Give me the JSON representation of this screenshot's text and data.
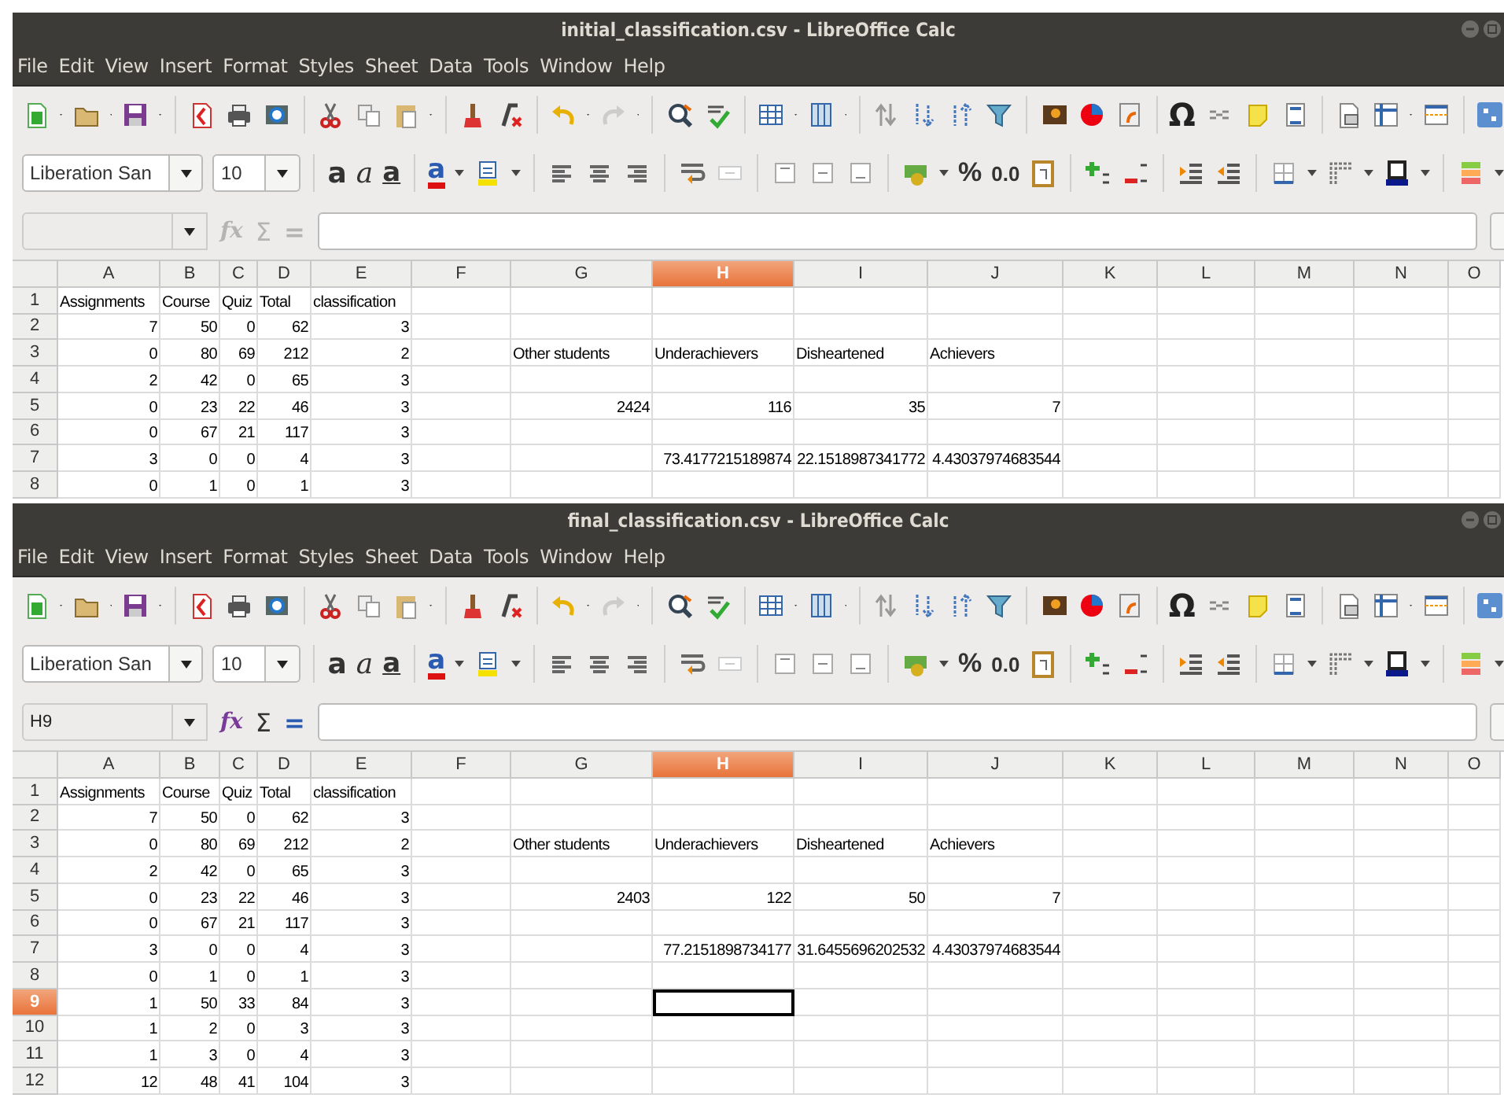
{
  "windows": [
    {
      "title": "initial_classification.csv - LibreOffice Calc",
      "menu": [
        "File",
        "Edit",
        "View",
        "Insert",
        "Format",
        "Styles",
        "Sheet",
        "Data",
        "Tools",
        "Window",
        "Help"
      ],
      "standard_glyphs": [
        {
          "kind": "omega",
          "text": "Ω"
        }
      ],
      "format_toolbar": {
        "font_name": "Liberation San",
        "font_size": "10",
        "glyphs": [
          {
            "kind": "bold",
            "text": "a"
          },
          {
            "kind": "italic",
            "text": "a"
          },
          {
            "kind": "underline",
            "text": "a"
          },
          {
            "kind": "font-color",
            "text": "a"
          },
          {
            "kind": "percent",
            "text": "%"
          },
          {
            "kind": "decimal",
            "text": "0.0"
          }
        ]
      },
      "formula_bar": {
        "buttons": [
          {
            "text": "fx",
            "kind": "function",
            "disabled": true
          },
          {
            "text": "Σ",
            "kind": "sum",
            "disabled": true
          },
          {
            "text": "=",
            "kind": "equals",
            "disabled": true
          }
        ]
      },
      "columns": [
        {
          "label": "A",
          "selected": false
        },
        {
          "label": "B",
          "selected": false
        },
        {
          "label": "C",
          "selected": false
        },
        {
          "label": "D",
          "selected": false
        },
        {
          "label": "E",
          "selected": false
        },
        {
          "label": "F",
          "selected": false
        },
        {
          "label": "G",
          "selected": false
        },
        {
          "label": "H",
          "selected": true
        },
        {
          "label": "I",
          "selected": false
        },
        {
          "label": "J",
          "selected": false
        },
        {
          "label": "K",
          "selected": false
        },
        {
          "label": "L",
          "selected": false
        },
        {
          "label": "M",
          "selected": false
        },
        {
          "label": "N",
          "selected": false
        },
        {
          "label": "O",
          "selected": false
        }
      ],
      "rows": [
        {
          "number": "1",
          "selected": false,
          "cells": [
            {
              "text": "Assignments",
              "kind": "text"
            },
            {
              "text": "Course",
              "kind": "text"
            },
            {
              "text": "Quiz",
              "kind": "text"
            },
            {
              "text": "Total",
              "kind": "text"
            },
            {
              "text": "classification",
              "kind": "text"
            }
          ]
        },
        {
          "number": "2",
          "selected": false,
          "cells": [
            {
              "text": "7",
              "kind": "number"
            },
            {
              "text": "50",
              "kind": "number"
            },
            {
              "text": "0",
              "kind": "number"
            },
            {
              "text": "62",
              "kind": "number"
            },
            {
              "text": "3",
              "kind": "number"
            }
          ]
        },
        {
          "number": "3",
          "selected": false,
          "cells": [
            {
              "text": "0",
              "kind": "number"
            },
            {
              "text": "80",
              "kind": "number"
            },
            {
              "text": "69",
              "kind": "number"
            },
            {
              "text": "212",
              "kind": "number"
            },
            {
              "text": "2",
              "kind": "number"
            },
            null,
            {
              "text": "Other students",
              "kind": "text"
            },
            {
              "text": "Underachievers",
              "kind": "text"
            },
            {
              "text": "Disheartened",
              "kind": "text"
            },
            {
              "text": "Achievers",
              "kind": "text"
            }
          ]
        },
        {
          "number": "4",
          "selected": false,
          "cells": [
            {
              "text": "2",
              "kind": "number"
            },
            {
              "text": "42",
              "kind": "number"
            },
            {
              "text": "0",
              "kind": "number"
            },
            {
              "text": "65",
              "kind": "number"
            },
            {
              "text": "3",
              "kind": "number"
            }
          ]
        },
        {
          "number": "5",
          "selected": false,
          "cells": [
            {
              "text": "0",
              "kind": "number"
            },
            {
              "text": "23",
              "kind": "number"
            },
            {
              "text": "22",
              "kind": "number"
            },
            {
              "text": "46",
              "kind": "number"
            },
            {
              "text": "3",
              "kind": "number"
            },
            null,
            {
              "text": "2424",
              "kind": "number"
            },
            {
              "text": "116",
              "kind": "number"
            },
            {
              "text": "35",
              "kind": "number"
            },
            {
              "text": "7",
              "kind": "number"
            }
          ]
        },
        {
          "number": "6",
          "selected": false,
          "cells": [
            {
              "text": "0",
              "kind": "number"
            },
            {
              "text": "67",
              "kind": "number"
            },
            {
              "text": "21",
              "kind": "number"
            },
            {
              "text": "117",
              "kind": "number"
            },
            {
              "text": "3",
              "kind": "number"
            }
          ]
        },
        {
          "number": "7",
          "selected": false,
          "cells": [
            {
              "text": "3",
              "kind": "number"
            },
            {
              "text": "0",
              "kind": "number"
            },
            {
              "text": "0",
              "kind": "number"
            },
            {
              "text": "4",
              "kind": "number"
            },
            {
              "text": "3",
              "kind": "number"
            },
            null,
            null,
            {
              "text": "73.4177215189874",
              "kind": "number"
            },
            {
              "text": "22.1518987341772",
              "kind": "number"
            },
            {
              "text": "4.43037974683544",
              "kind": "number"
            }
          ]
        },
        {
          "number": "8",
          "selected": false,
          "cells": [
            {
              "text": "0",
              "kind": "number"
            },
            {
              "text": "1",
              "kind": "number"
            },
            {
              "text": "0",
              "kind": "number"
            },
            {
              "text": "1",
              "kind": "number"
            },
            {
              "text": "3",
              "kind": "number"
            }
          ]
        }
      ]
    },
    {
      "title": "final_classification.csv - LibreOffice Calc",
      "menu": [
        "File",
        "Edit",
        "View",
        "Insert",
        "Format",
        "Styles",
        "Sheet",
        "Data",
        "Tools",
        "Window",
        "Help"
      ],
      "standard_glyphs": [
        {
          "kind": "omega",
          "text": "Ω"
        }
      ],
      "format_toolbar": {
        "font_name": "Liberation San",
        "font_size": "10",
        "glyphs": [
          {
            "kind": "bold",
            "text": "a"
          },
          {
            "kind": "italic",
            "text": "a"
          },
          {
            "kind": "underline",
            "text": "a"
          },
          {
            "kind": "font-color",
            "text": "a"
          },
          {
            "kind": "percent",
            "text": "%"
          },
          {
            "kind": "decimal",
            "text": "0.0"
          }
        ]
      },
      "formula_bar": {
        "cell_reference": "H9",
        "buttons": [
          {
            "text": "fx",
            "kind": "function",
            "disabled": false
          },
          {
            "text": "Σ",
            "kind": "sum",
            "disabled": false
          },
          {
            "text": "=",
            "kind": "equals",
            "disabled": false
          }
        ]
      },
      "columns": [
        {
          "label": "A",
          "selected": false
        },
        {
          "label": "B",
          "selected": false
        },
        {
          "label": "C",
          "selected": false
        },
        {
          "label": "D",
          "selected": false
        },
        {
          "label": "E",
          "selected": false
        },
        {
          "label": "F",
          "selected": false
        },
        {
          "label": "G",
          "selected": false
        },
        {
          "label": "H",
          "selected": true
        },
        {
          "label": "I",
          "selected": false
        },
        {
          "label": "J",
          "selected": false
        },
        {
          "label": "K",
          "selected": false
        },
        {
          "label": "L",
          "selected": false
        },
        {
          "label": "M",
          "selected": false
        },
        {
          "label": "N",
          "selected": false
        },
        {
          "label": "O",
          "selected": false
        }
      ],
      "rows": [
        {
          "number": "1",
          "selected": false,
          "cells": [
            {
              "text": "Assignments",
              "kind": "text"
            },
            {
              "text": "Course",
              "kind": "text"
            },
            {
              "text": "Quiz",
              "kind": "text"
            },
            {
              "text": "Total",
              "kind": "text"
            },
            {
              "text": "classification",
              "kind": "text"
            }
          ]
        },
        {
          "number": "2",
          "selected": false,
          "cells": [
            {
              "text": "7",
              "kind": "number"
            },
            {
              "text": "50",
              "kind": "number"
            },
            {
              "text": "0",
              "kind": "number"
            },
            {
              "text": "62",
              "kind": "number"
            },
            {
              "text": "3",
              "kind": "number"
            }
          ]
        },
        {
          "number": "3",
          "selected": false,
          "cells": [
            {
              "text": "0",
              "kind": "number"
            },
            {
              "text": "80",
              "kind": "number"
            },
            {
              "text": "69",
              "kind": "number"
            },
            {
              "text": "212",
              "kind": "number"
            },
            {
              "text": "2",
              "kind": "number"
            },
            null,
            {
              "text": "Other students",
              "kind": "text"
            },
            {
              "text": "Underachievers",
              "kind": "text"
            },
            {
              "text": "Disheartened",
              "kind": "text"
            },
            {
              "text": "Achievers",
              "kind": "text"
            }
          ]
        },
        {
          "number": "4",
          "selected": false,
          "cells": [
            {
              "text": "2",
              "kind": "number"
            },
            {
              "text": "42",
              "kind": "number"
            },
            {
              "text": "0",
              "kind": "number"
            },
            {
              "text": "65",
              "kind": "number"
            },
            {
              "text": "3",
              "kind": "number"
            }
          ]
        },
        {
          "number": "5",
          "selected": false,
          "cells": [
            {
              "text": "0",
              "kind": "number"
            },
            {
              "text": "23",
              "kind": "number"
            },
            {
              "text": "22",
              "kind": "number"
            },
            {
              "text": "46",
              "kind": "number"
            },
            {
              "text": "3",
              "kind": "number"
            },
            null,
            {
              "text": "2403",
              "kind": "number"
            },
            {
              "text": "122",
              "kind": "number"
            },
            {
              "text": "50",
              "kind": "number"
            },
            {
              "text": "7",
              "kind": "number"
            }
          ]
        },
        {
          "number": "6",
          "selected": false,
          "cells": [
            {
              "text": "0",
              "kind": "number"
            },
            {
              "text": "67",
              "kind": "number"
            },
            {
              "text": "21",
              "kind": "number"
            },
            {
              "text": "117",
              "kind": "number"
            },
            {
              "text": "3",
              "kind": "number"
            }
          ]
        },
        {
          "number": "7",
          "selected": false,
          "cells": [
            {
              "text": "3",
              "kind": "number"
            },
            {
              "text": "0",
              "kind": "number"
            },
            {
              "text": "0",
              "kind": "number"
            },
            {
              "text": "4",
              "kind": "number"
            },
            {
              "text": "3",
              "kind": "number"
            },
            null,
            null,
            {
              "text": "77.2151898734177",
              "kind": "number"
            },
            {
              "text": "31.6455696202532",
              "kind": "number"
            },
            {
              "text": "4.43037974683544",
              "kind": "number"
            }
          ]
        },
        {
          "number": "8",
          "selected": false,
          "cells": [
            {
              "text": "0",
              "kind": "number"
            },
            {
              "text": "1",
              "kind": "number"
            },
            {
              "text": "0",
              "kind": "number"
            },
            {
              "text": "1",
              "kind": "number"
            },
            {
              "text": "3",
              "kind": "number"
            }
          ]
        },
        {
          "number": "9",
          "selected": true,
          "cells": [
            {
              "text": "1",
              "kind": "number"
            },
            {
              "text": "50",
              "kind": "number"
            },
            {
              "text": "33",
              "kind": "number"
            },
            {
              "text": "84",
              "kind": "number"
            },
            {
              "text": "3",
              "kind": "number"
            }
          ]
        },
        {
          "number": "10",
          "selected": false,
          "cells": [
            {
              "text": "1",
              "kind": "number"
            },
            {
              "text": "2",
              "kind": "number"
            },
            {
              "text": "0",
              "kind": "number"
            },
            {
              "text": "3",
              "kind": "number"
            },
            {
              "text": "3",
              "kind": "number"
            }
          ]
        },
        {
          "number": "11",
          "selected": false,
          "cells": [
            {
              "text": "1",
              "kind": "number"
            },
            {
              "text": "3",
              "kind": "number"
            },
            {
              "text": "0",
              "kind": "number"
            },
            {
              "text": "4",
              "kind": "number"
            },
            {
              "text": "3",
              "kind": "number"
            }
          ]
        },
        {
          "number": "12",
          "selected": false,
          "cells": [
            {
              "text": "12",
              "kind": "number"
            },
            {
              "text": "48",
              "kind": "number"
            },
            {
              "text": "41",
              "kind": "number"
            },
            {
              "text": "104",
              "kind": "number"
            },
            {
              "text": "3",
              "kind": "number"
            }
          ]
        }
      ]
    }
  ]
}
